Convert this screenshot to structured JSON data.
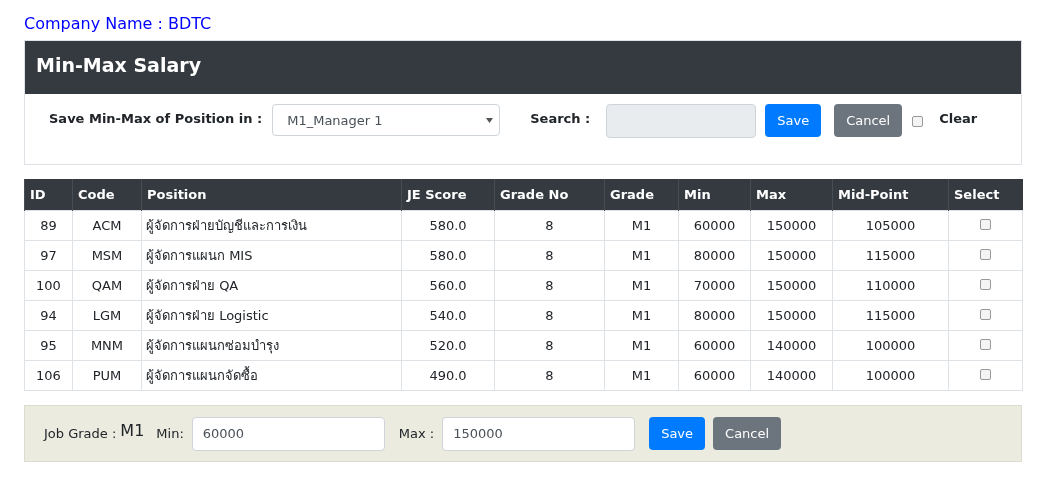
{
  "company": "Company Name : BDTC",
  "panel": {
    "title": "Min-Max Salary",
    "position_label": "Save Min-Max of Position in :",
    "position_select": "M1_Manager 1",
    "search_label": "Search :",
    "save": "Save",
    "cancel": "Cancel",
    "clear": {
      "label": "Clear",
      "checked": false
    }
  },
  "table": {
    "columns": [
      "ID",
      "Code",
      "Position",
      "JE Score",
      "Grade No",
      "Grade",
      "Min",
      "Max",
      "Mid-Point",
      "Select"
    ],
    "rows": [
      {
        "cells": [
          "89",
          "ACM",
          "ผู้จัดการฝ่ายบัญชีและการเงิน",
          "580.0",
          "8",
          "M1",
          "60000",
          "150000",
          "105000"
        ],
        "checked": false
      },
      {
        "cells": [
          "97",
          "MSM",
          "ผู้จัดการแผนก MIS",
          "580.0",
          "8",
          "M1",
          "80000",
          "150000",
          "115000"
        ],
        "checked": false
      },
      {
        "cells": [
          "100",
          "QAM",
          "ผู้จัดการฝ่าย QA",
          "560.0",
          "8",
          "M1",
          "70000",
          "150000",
          "110000"
        ],
        "checked": false
      },
      {
        "cells": [
          "94",
          "LGM",
          "ผู้จัดการฝ่าย Logistic",
          "540.0",
          "8",
          "M1",
          "80000",
          "150000",
          "115000"
        ],
        "checked": false
      },
      {
        "cells": [
          "95",
          "MNM",
          "ผู้จัดการแผนกซ่อมบำรุง",
          "520.0",
          "8",
          "M1",
          "60000",
          "140000",
          "100000"
        ],
        "checked": false
      },
      {
        "cells": [
          "106",
          "PUM",
          "ผู้จัดการแผนกจัดซื้อ",
          "490.0",
          "8",
          "M1",
          "60000",
          "140000",
          "100000"
        ],
        "checked": false
      }
    ]
  },
  "editor": {
    "job_grade_label": "Job Grade :",
    "job_grade": "M1",
    "min_label": "Min:",
    "min_value": "60000",
    "max_label": "Max :",
    "max_value": "150000",
    "save": "Save",
    "cancel": "Cancel"
  }
}
